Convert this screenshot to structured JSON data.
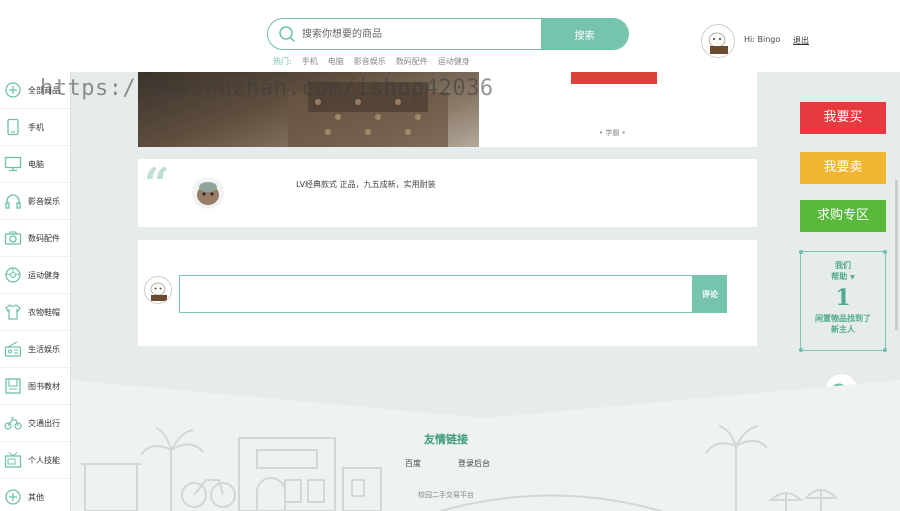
{
  "header": {
    "search_placeholder": "搜索你想要的商品",
    "search_button": "搜索",
    "hot_label": "热门:",
    "hot_items": [
      "手机",
      "电脑",
      "影音娱乐",
      "数码配件",
      "运动健身"
    ],
    "greeting": "Hi: Bingo",
    "logout": "退出"
  },
  "sidebar": {
    "items": [
      {
        "label": "全部商品",
        "icon": "plus-circle-icon"
      },
      {
        "label": "手机",
        "icon": "phone-icon"
      },
      {
        "label": "电脑",
        "icon": "computer-icon"
      },
      {
        "label": "影音娱乐",
        "icon": "headphones-icon"
      },
      {
        "label": "数码配件",
        "icon": "camera-icon"
      },
      {
        "label": "运动健身",
        "icon": "ball-icon"
      },
      {
        "label": "衣物鞋帽",
        "icon": "shirt-icon"
      },
      {
        "label": "生活娱乐",
        "icon": "radio-icon"
      },
      {
        "label": "图书教材",
        "icon": "book-icon"
      },
      {
        "label": "交通出行",
        "icon": "bike-icon"
      },
      {
        "label": "个人技能",
        "icon": "tv-icon"
      },
      {
        "label": "其他",
        "icon": "plus-circle-icon"
      }
    ]
  },
  "watermark": "https://www.huzhan.com/ishop42036",
  "product": {
    "thumb_label": "• 学霸 •"
  },
  "description": {
    "quote": "“",
    "text": "LV经典款式 正品，九五成新，实用耐装"
  },
  "comment": {
    "button": "评论"
  },
  "actions": {
    "buy": "我要买",
    "sell": "我要卖",
    "want": "求购专区"
  },
  "helped": {
    "top_line1": "我们",
    "top_line2": "帮助",
    "count": "1",
    "bottom_line1": "闲置物品找到了",
    "bottom_line2": "新主人"
  },
  "footer": {
    "title": "友情链接",
    "link1": "百度",
    "link2": "登录后台",
    "copyright": "校园二手交易平台"
  },
  "colors": {
    "accent": "#77c4ae",
    "buy": "#e73a3f",
    "sell": "#f0b532",
    "want": "#58b93a"
  }
}
